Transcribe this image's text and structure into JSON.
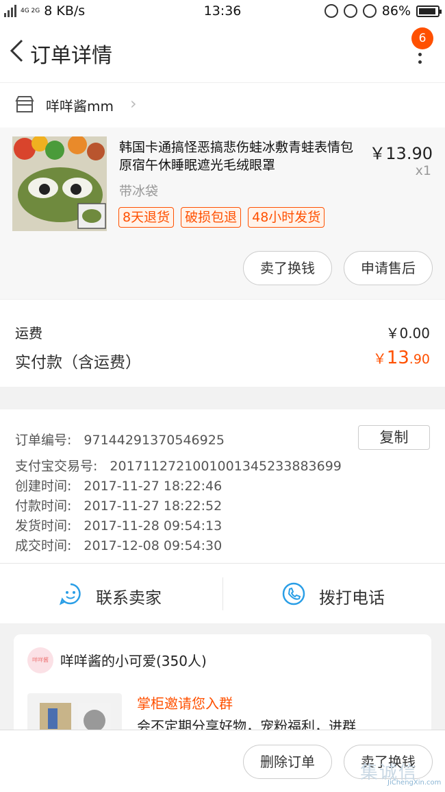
{
  "status": {
    "network": "4G 2G",
    "speed": "8 KB/s",
    "time": "13:36",
    "battery": "86%"
  },
  "header": {
    "title": "订单详情",
    "badge": "6"
  },
  "shop": {
    "name": "咩咩酱mm"
  },
  "item": {
    "title": "韩国卡通搞怪恶搞悲伤蛙冰敷青蛙表情包原宿午休睡眠遮光毛绒眼罩",
    "price": "￥13.90",
    "qty": "x1",
    "sku": "带冰袋",
    "tags": [
      "8天退货",
      "破损包退",
      "48小时发货"
    ],
    "buttons": {
      "sell": "卖了换钱",
      "aftersale": "申请售后"
    }
  },
  "fees": {
    "shipping_label": "运费",
    "shipping_value": "￥0.00",
    "paid_label": "实付款（含运费）",
    "paid_prefix": "￥",
    "paid_int": "13",
    "paid_dec": ".90"
  },
  "order_info": {
    "copy_label": "复制",
    "rows": [
      {
        "label": "订单编号:",
        "value": "97144291370546925"
      },
      {
        "label": "支付宝交易号:",
        "value": "2017112721001001345233883699"
      },
      {
        "label": "创建时间:",
        "value": "2017-11-27 18:22:46"
      },
      {
        "label": "付款时间:",
        "value": "2017-11-27 18:22:52"
      },
      {
        "label": "发货时间:",
        "value": "2017-11-28 09:54:13"
      },
      {
        "label": "成交时间:",
        "value": "2017-12-08 09:54:30"
      }
    ]
  },
  "contact": {
    "seller": "联系卖家",
    "call": "拨打电话"
  },
  "group": {
    "avatar_text": "咩咩酱",
    "name": "咩咩酱的小可爱(350人)",
    "invite": "掌柜邀请您入群",
    "desc": "会不定期分享好物，宠粉福利，进群"
  },
  "bottom": {
    "delete": "删除订单",
    "sell": "卖了换钱"
  },
  "watermark": {
    "cn": "集诚信",
    "en": "JiChengXin.com"
  },
  "colors": {
    "accent": "#ff5000",
    "icon_blue": "#2a9ee6"
  }
}
